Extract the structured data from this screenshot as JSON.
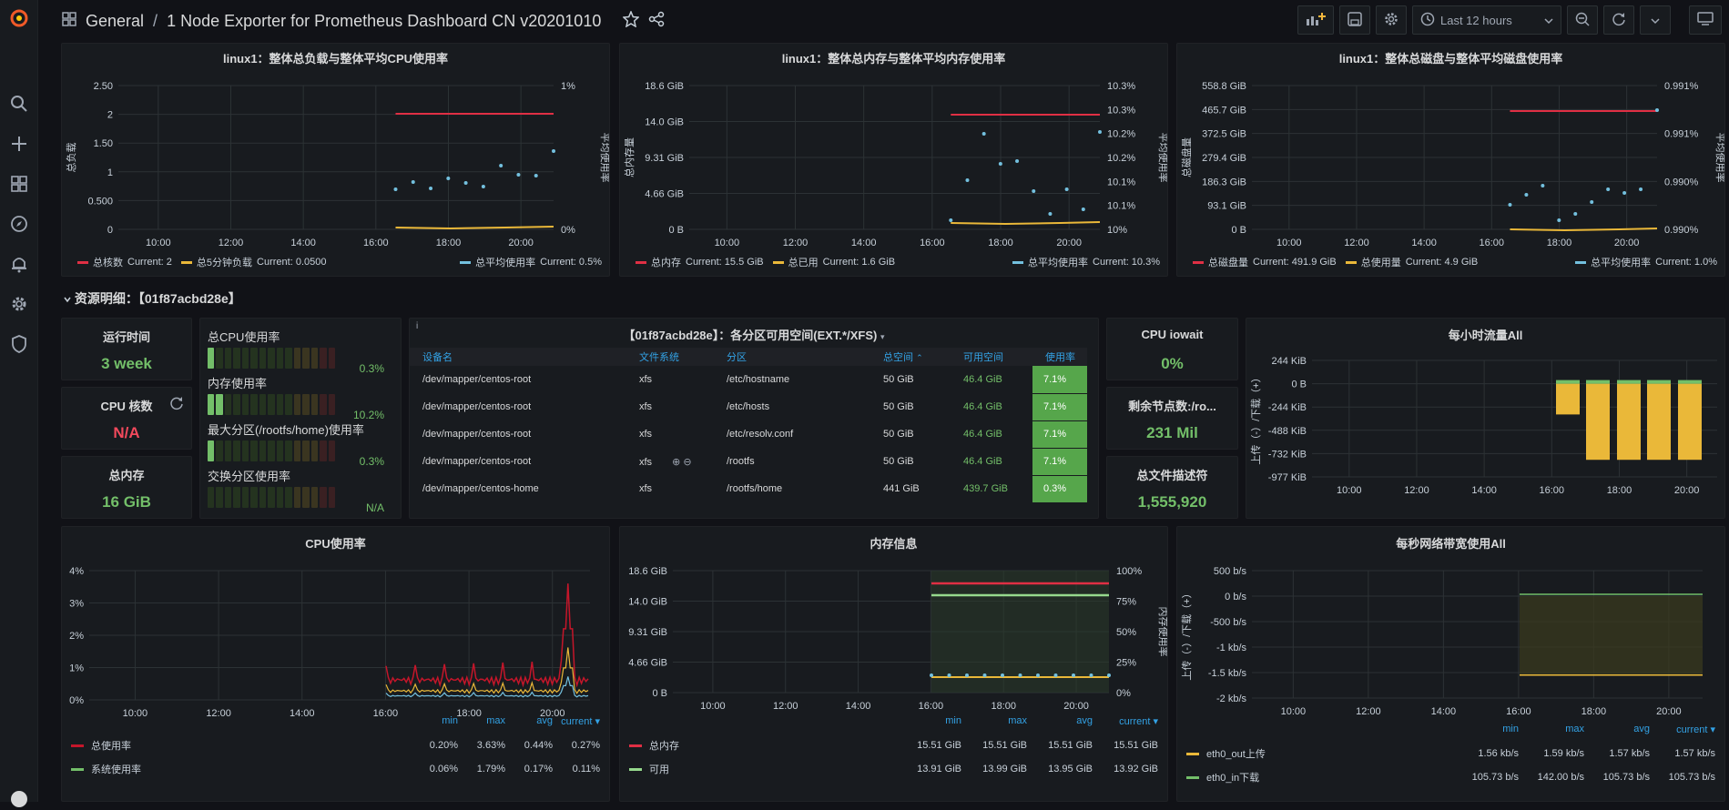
{
  "header": {
    "folder": "General",
    "separator": "/",
    "title": "1 Node Exporter for Prometheus Dashboard CN v20201010",
    "time_range": "Last 12 hours"
  },
  "colors": {
    "red": "#e02f44",
    "yellow": "#eab839",
    "blue": "#73c0de",
    "green": "#73bf69",
    "deepred": "#f2495c",
    "olive": "#96d98d"
  },
  "row_title": "资源明细：【01f87acbd28e】",
  "panels": {
    "cpu_load": {
      "title": "linux1：整体总负载与整体平均CPU使用率",
      "ylabel_left": "总负载",
      "ylabel_right": "平均使用率",
      "yticks_left": [
        "2.50",
        "2",
        "1.50",
        "1",
        "0.500",
        "0"
      ],
      "yticks_right": [
        "1%",
        "0%"
      ],
      "xticks": [
        "10:00",
        "12:00",
        "14:00",
        "16:00",
        "18:00",
        "20:00"
      ],
      "legend": [
        {
          "name": "总核数",
          "current": "Current: 2"
        },
        {
          "name": "总5分钟负载",
          "current": "Current: 0.0500"
        },
        {
          "name": "总平均使用率",
          "current": "Current: 0.5%"
        }
      ]
    },
    "mem_total": {
      "title": "linux1：整体总内存与整体平均内存使用率",
      "ylabel_left": "总内存量",
      "ylabel_right": "平均使用率",
      "yticks_left": [
        "18.6 GiB",
        "14.0 GiB",
        "9.31 GiB",
        "4.66 GiB",
        "0 B"
      ],
      "yticks_right": [
        "10.3%",
        "10.3%",
        "10.2%",
        "10.2%",
        "10.1%",
        "10.1%",
        "10%"
      ],
      "xticks": [
        "10:00",
        "12:00",
        "14:00",
        "16:00",
        "18:00",
        "20:00"
      ],
      "legend": [
        {
          "name": "总内存",
          "current": "Current: 15.5 GiB"
        },
        {
          "name": "总已用",
          "current": "Current: 1.6 GiB"
        },
        {
          "name": "总平均使用率",
          "current": "Current: 10.3%"
        }
      ]
    },
    "disk_total": {
      "title": "linux1：整体总磁盘与整体平均磁盘使用率",
      "ylabel_left": "总磁盘量",
      "ylabel_right": "平均使用率",
      "yticks_left": [
        "558.8 GiB",
        "465.7 GiB",
        "372.5 GiB",
        "279.4 GiB",
        "186.3 GiB",
        "93.1 GiB",
        "0 B"
      ],
      "yticks_right": [
        "0.991%",
        "0.991%",
        "0.990%",
        "0.990%"
      ],
      "xticks": [
        "10:00",
        "12:00",
        "14:00",
        "16:00",
        "18:00",
        "20:00"
      ],
      "legend": [
        {
          "name": "总磁盘量",
          "current": "Current: 491.9 GiB"
        },
        {
          "name": "总使用量",
          "current": "Current: 4.9 GiB"
        },
        {
          "name": "总平均使用率",
          "current": "Current: 1.0%"
        }
      ]
    },
    "uptime": {
      "title": "运行时间",
      "value": "3 week"
    },
    "cpu_cores": {
      "title": "CPU 核数",
      "value": "N/A"
    },
    "total_mem": {
      "title": "总内存",
      "value": "16 GiB"
    },
    "gauges": [
      {
        "label": "总CPU使用率",
        "value": "0.3%",
        "level": 0.03
      },
      {
        "label": "内存使用率",
        "value": "10.2%",
        "level": 0.102
      },
      {
        "label": "最大分区(/rootfs/home)使用率",
        "value": "0.3%",
        "level": 0.03
      },
      {
        "label": "交换分区使用率",
        "value": "N/A",
        "level": 0
      }
    ],
    "partitions": {
      "title": "【01f87acbd28e】：各分区可用空间(EXT.*/XFS)",
      "headers": [
        "设备名",
        "文件系统",
        "分区",
        "总空间",
        "可用空间",
        "使用率"
      ],
      "rows": [
        {
          "dev": "/dev/mapper/centos-root",
          "fs": "xfs",
          "mount": "/etc/hostname",
          "size": "50 GiB",
          "avail": "46.4 GiB",
          "used": "7.1%"
        },
        {
          "dev": "/dev/mapper/centos-root",
          "fs": "xfs",
          "mount": "/etc/hosts",
          "size": "50 GiB",
          "avail": "46.4 GiB",
          "used": "7.1%"
        },
        {
          "dev": "/dev/mapper/centos-root",
          "fs": "xfs",
          "mount": "/etc/resolv.conf",
          "size": "50 GiB",
          "avail": "46.4 GiB",
          "used": "7.1%"
        },
        {
          "dev": "/dev/mapper/centos-root",
          "fs": "xfs",
          "mount": "/rootfs",
          "size": "50 GiB",
          "avail": "46.4 GiB",
          "used": "7.1%"
        },
        {
          "dev": "/dev/mapper/centos-home",
          "fs": "xfs",
          "mount": "/rootfs/home",
          "size": "441 GiB",
          "avail": "439.7 GiB",
          "used": "0.3%"
        }
      ]
    },
    "cpu_iowait": {
      "title": "CPU iowait",
      "value": "0%"
    },
    "inodes": {
      "title": "剩余节点数:/ro...",
      "value": "231 Mil"
    },
    "fd": {
      "title": "总文件描述符",
      "value": "1,555,920"
    },
    "traffic": {
      "title": "每小时流量All",
      "ylabel": "上传（-）/下载（+）",
      "yticks": [
        "244 KiB",
        "0 B",
        "-244 KiB",
        "-488 KiB",
        "-732 KiB",
        "-977 KiB"
      ],
      "xticks": [
        "10:00",
        "12:00",
        "14:00",
        "16:00",
        "18:00",
        "20:00"
      ]
    },
    "cpu_usage": {
      "title": "CPU使用率",
      "yticks": [
        "4%",
        "3%",
        "2%",
        "1%",
        "0%"
      ],
      "xticks": [
        "10:00",
        "12:00",
        "14:00",
        "16:00",
        "18:00",
        "20:00"
      ],
      "headers": [
        "min",
        "max",
        "avg",
        "current"
      ],
      "rows": [
        {
          "name": "总使用率",
          "min": "0.20%",
          "max": "3.63%",
          "avg": "0.44%",
          "current": "0.27%"
        },
        {
          "name": "系统使用率",
          "min": "0.06%",
          "max": "1.79%",
          "avg": "0.17%",
          "current": "0.11%"
        }
      ]
    },
    "mem_info": {
      "title": "内存信息",
      "ylabel_right": "内存使用率",
      "yticks_left": [
        "18.6 GiB",
        "14.0 GiB",
        "9.31 GiB",
        "4.66 GiB",
        "0 B"
      ],
      "yticks_right": [
        "100%",
        "75%",
        "50%",
        "25%",
        "0%"
      ],
      "xticks": [
        "10:00",
        "12:00",
        "14:00",
        "16:00",
        "18:00",
        "20:00"
      ],
      "headers": [
        "min",
        "max",
        "avg",
        "current"
      ],
      "rows": [
        {
          "name": "总内存",
          "min": "15.51 GiB",
          "max": "15.51 GiB",
          "avg": "15.51 GiB",
          "current": "15.51 GiB"
        },
        {
          "name": "可用",
          "min": "13.91 GiB",
          "max": "13.99 GiB",
          "avg": "13.95 GiB",
          "current": "13.92 GiB"
        }
      ]
    },
    "net": {
      "title": "每秒网络带宽使用All",
      "ylabel": "上传（-）/下载（+）",
      "yticks": [
        "500 b/s",
        "0 b/s",
        "-500 b/s",
        "-1 kb/s",
        "-1.5 kb/s",
        "-2 kb/s"
      ],
      "xticks": [
        "10:00",
        "12:00",
        "14:00",
        "16:00",
        "18:00",
        "20:00"
      ],
      "headers": [
        "min",
        "max",
        "avg",
        "current"
      ],
      "rows": [
        {
          "name": "eth0_out上传",
          "min": "1.56 kb/s",
          "max": "1.59 kb/s",
          "avg": "1.57 kb/s",
          "current": "1.57 kb/s"
        },
        {
          "name": "eth0_in下载",
          "min": "105.73 b/s",
          "max": "142.00 b/s",
          "avg": "105.73 b/s",
          "current": "105.73 b/s"
        }
      ]
    }
  }
}
